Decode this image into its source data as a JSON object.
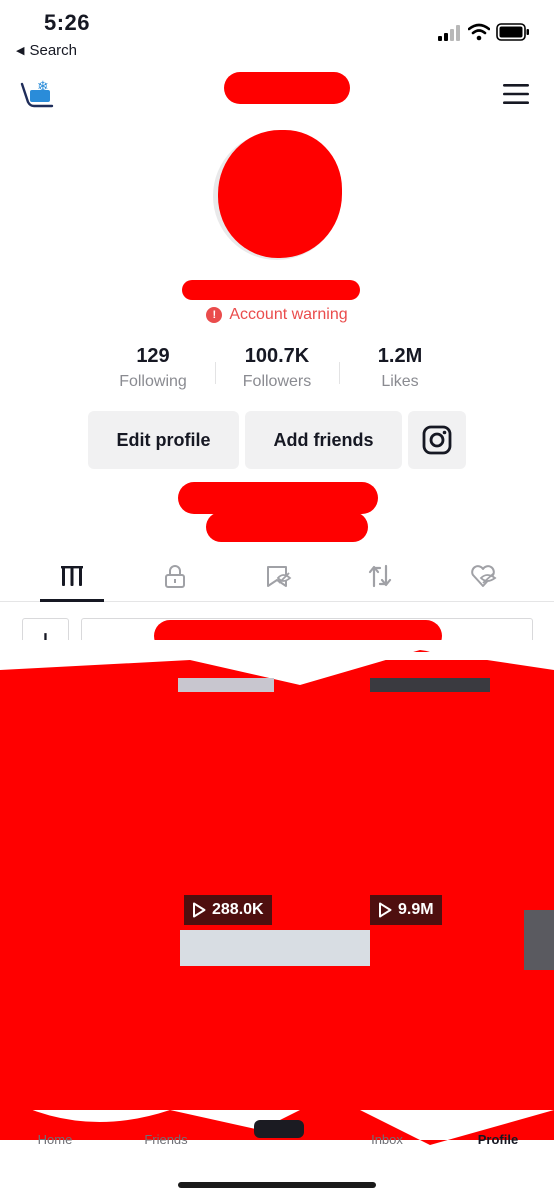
{
  "status_bar": {
    "time": "5:26",
    "back_label": "Search"
  },
  "profile": {
    "account_warning": "Account warning",
    "stats": [
      {
        "value": "129",
        "label": "Following"
      },
      {
        "value": "100.7K",
        "label": "Followers"
      },
      {
        "value": "1.2M",
        "label": "Likes"
      }
    ],
    "buttons": {
      "edit_profile": "Edit profile",
      "add_friends": "Add friends"
    }
  },
  "videos": [
    {
      "views": "288.0K"
    },
    {
      "views": "9.9M"
    }
  ],
  "bottom_nav": [
    {
      "label": "Home"
    },
    {
      "label": "Friends"
    },
    {
      "label": "Inbox"
    },
    {
      "label": "Profile"
    }
  ],
  "colors": {
    "warning": "#ea4c4c",
    "redaction": "#ff0000",
    "button_bg": "#f1f1f2"
  }
}
